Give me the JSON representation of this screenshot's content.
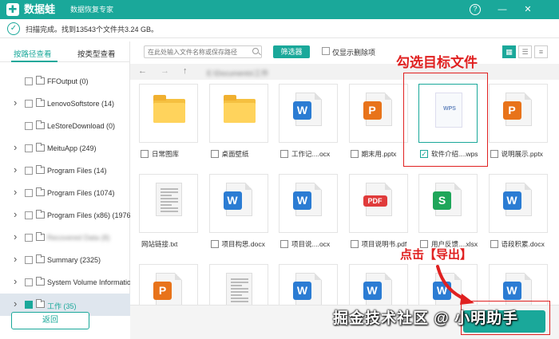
{
  "titlebar": {
    "app_name": "数据蛙",
    "subtitle": "数据恢复专家",
    "help_icon": "?",
    "min_icon": "—",
    "close_icon": "✕"
  },
  "status": {
    "message": "扫描完成。找到13543个文件共3.24 GB。"
  },
  "sidebar": {
    "tabs": [
      {
        "label": "按路径查看",
        "active": true
      },
      {
        "label": "按类型查看",
        "active": false
      }
    ],
    "tree": [
      {
        "label": "FFOutput (0)",
        "expandable": false
      },
      {
        "label": "LenovoSoftstore (14)",
        "expandable": true
      },
      {
        "label": "LeStoreDownload (0)",
        "expandable": false
      },
      {
        "label": "MeituApp (249)",
        "expandable": true
      },
      {
        "label": "Program Files (14)",
        "expandable": true
      },
      {
        "label": "Program Files (1074)",
        "expandable": true
      },
      {
        "label": "Program Files (x86) (1976)",
        "expandable": true
      },
      {
        "label": "Recovered Data (8)",
        "expandable": true,
        "blurred": true
      },
      {
        "label": "Summary (2325)",
        "expandable": true
      },
      {
        "label": "System Volume Information",
        "expandable": true
      },
      {
        "label": "工作 (35)",
        "expandable": true,
        "active": true
      }
    ],
    "return_label": "返回"
  },
  "toolbar": {
    "search_placeholder": "在此处输入文件名称或保存路径",
    "filter_label": "筛选器",
    "deleted_only_label": "仅显示删除项",
    "views": [
      "grid-view-icon",
      "list-view-icon",
      "detail-view-icon"
    ]
  },
  "nav": {
    "back": "←",
    "forward": "→",
    "up": "↑",
    "path": "E:\\Documents\\工作"
  },
  "files": [
    {
      "name": "日常图库",
      "type": "folder",
      "checked": false
    },
    {
      "name": "桌面壁纸",
      "type": "folder",
      "checked": false
    },
    {
      "name": "工作记....ocx",
      "type": "word",
      "checked": false
    },
    {
      "name": "期末用.pptx",
      "type": "ppt",
      "checked": false
    },
    {
      "name": "软件介绍....wps",
      "type": "wps",
      "checked": true
    },
    {
      "name": "说明展示.pptx",
      "type": "ppt",
      "checked": false
    },
    {
      "name": "网站链接.txt",
      "type": "txt",
      "checked": false,
      "no_checkbox": true
    },
    {
      "name": "项目构思.docx",
      "type": "word",
      "checked": false
    },
    {
      "name": "项目说....ocx",
      "type": "word",
      "checked": false
    },
    {
      "name": "项目说明书.pdf",
      "type": "pdf",
      "checked": false
    },
    {
      "name": "用户反馈....xlsx",
      "type": "excel",
      "checked": false
    },
    {
      "name": "语段积累.docx",
      "type": "word",
      "checked": false
    },
    {
      "name": "",
      "type": "ppt",
      "checked": false
    },
    {
      "name": "",
      "type": "txt",
      "checked": false
    },
    {
      "name": "",
      "type": "word",
      "checked": false
    },
    {
      "name": "",
      "type": "word",
      "checked": false
    },
    {
      "name": "",
      "type": "word",
      "checked": false
    },
    {
      "name": "",
      "type": "word",
      "checked": false
    }
  ],
  "badges": {
    "word": {
      "letter": "W",
      "color": "#2b7cd3"
    },
    "ppt": {
      "letter": "P",
      "color": "#e8731a"
    },
    "pdf": {
      "letter": "PDF",
      "color": "#e03b3b"
    },
    "excel": {
      "letter": "S",
      "color": "#1fa65a"
    },
    "wps_label": "WPS"
  },
  "annotations": {
    "select_target": "勾选目标文件",
    "click_export": "点击【导出】",
    "watermark": "掘金技术社区 @ 小明助手"
  },
  "colors": {
    "accent": "#1aa89a",
    "annotation": "#e02020",
    "folder": "#f5c040"
  }
}
